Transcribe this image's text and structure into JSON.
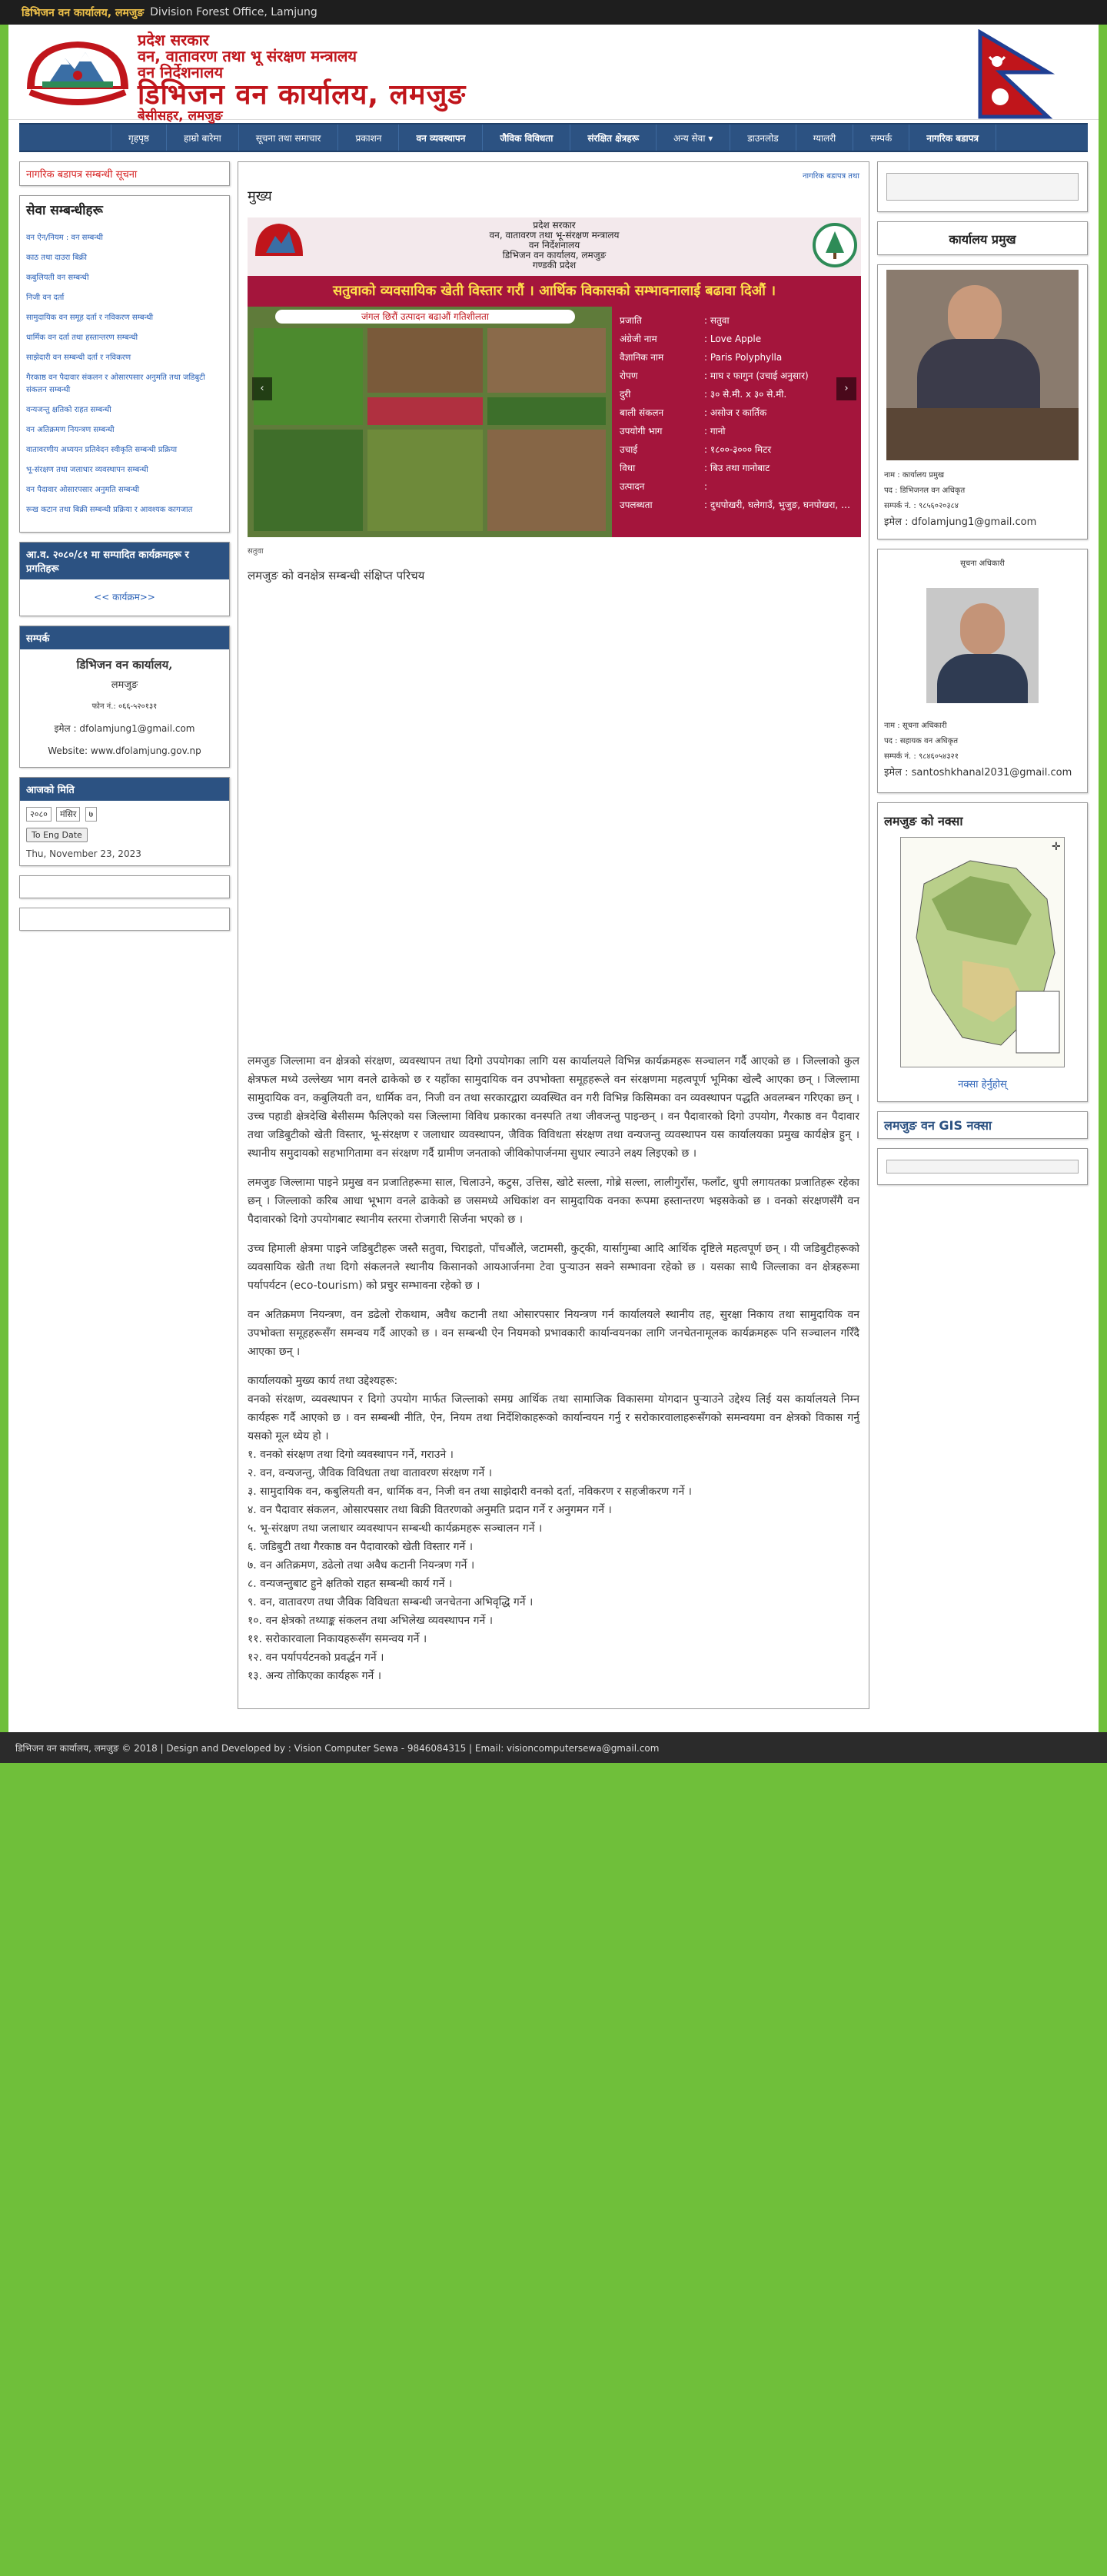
{
  "topbar": {
    "office_np": "डिभिजन वन कार्यालय, लमजुङ",
    "office_en": "Division Forest Office, Lamjung"
  },
  "header": {
    "line1": "प्रदेश सरकार",
    "line2": "वन, वातावरण तथा भू संरक्षण मन्त्रालय",
    "line3": "वन निर्देशनालय",
    "title": "डिभिजन वन कार्यालय, लमजुङ",
    "address": "बेसीसहर, लमजुङ"
  },
  "nav": [
    "गृहपृष्ठ",
    "हाम्रो बारेमा",
    "सूचना तथा समाचार",
    "प्रकाशन",
    "वन व्यवस्थापन",
    "जैविक विविधता",
    "संरक्षित क्षेत्रहरू",
    "अन्य सेवा ▾",
    "डाउनलोड",
    "ग्यालरी",
    "सम्पर्क",
    "नागरिक बडापत्र"
  ],
  "left": {
    "notice_title": "नागरिक बडापत्र सम्बन्धी सूचना",
    "services_title": "सेवा सम्बन्धीहरू",
    "service_links": [
      "वन ऐन/नियम : वन सम्बन्धी",
      "काठ तथा दाउरा बिक्री",
      "कबुलियती वन सम्बन्धी",
      "निजी वन दर्ता",
      "सामुदायिक वन समूह दर्ता र नविकरण सम्बन्धी",
      "धार्मिक वन दर्ता तथा हस्तान्तरण सम्बन्धी",
      "साझेदारी वन सम्बन्धी दर्ता र नविकरण",
      "गैरकाष्ठ वन पैदावार संकलन र ओसारपसार अनुमति तथा जडिबुटी संकलन सम्बन्धी",
      "वन्यजन्तु क्षतिको राहत सम्बन्धी",
      "वन अतिक्रमण नियन्त्रण सम्बन्धी",
      "वातावरणीय अध्ययन प्रतिवेदन स्वीकृति सम्बन्धी प्रक्रिया",
      "भू-संरक्षण तथा जलाधार व्यवस्थापन सम्बन्धी",
      "वन पैदावार ओसारपसार अनुमति सम्बन्धी",
      "रूख कटान तथा बिक्री सम्बन्धी प्रक्रिया र आवश्यक कागजात"
    ],
    "box3_title": "आ.व. २०८०/८१ मा सम्पादित कार्यक्रमहरू र प्रगतिहरू",
    "box3_link": "<< कार्यक्रम>>",
    "contact_title": "सम्पर्क",
    "contact_name": "डिभिजन वन कार्यालय,",
    "contact_place": "लमजुङ",
    "contact_phone": "फोन नं.: ०६६-५२०१३१",
    "contact_email": "इमेल : dfolamjung1@gmail.com",
    "contact_website": "Website: www.dfolamjung.gov.np",
    "date_title": "आजको मिति",
    "date_selects": [
      "२०८०",
      "मंसिर",
      "७"
    ],
    "date_button": "To Eng Date",
    "date_eng": "Thu, November 23, 2023"
  },
  "center": {
    "crumb": "नागरिक बडापत्र तथा",
    "title": "मुख्य",
    "banner": {
      "top1": "प्रदेश सरकार",
      "top2": "वन, वातावरण तथा भू-संरक्षण मन्त्रालय",
      "top3": "वन निर्देशनालय",
      "top4": "डिभिजन वन कार्यालय, लमजुङ",
      "top5": "गण्डकी प्रदेश",
      "slogan": "सतुवाको व्यवसायिक खेती विस्तार गरौं । आर्थिक विकासको सम्भावनालाई बढावा दिऔं ।",
      "tag": "जंगल छिरौं उत्पादन बढाऔं  गतिशीलता",
      "rows": [
        [
          "प्रजाति",
          ": सतुवा"
        ],
        [
          "अंग्रेजी नाम",
          ": Love Apple"
        ],
        [
          "वैज्ञानिक नाम",
          ": Paris Polyphylla"
        ],
        [
          "रोपण",
          ": माघ र फागुन (उचाई अनुसार)"
        ],
        [
          "दुरी",
          ": ३० से.मी. x ३० से.मी."
        ],
        [
          "बाली संकलन",
          ": असोज र कार्तिक"
        ],
        [
          "उपयोगी भाग",
          ": गानो"
        ],
        [
          "उचाई",
          ": १८००-३००० मिटर"
        ],
        [
          "विधा",
          ": बिउ तथा गानोबाट"
        ],
        [
          "उत्पादन",
          ":"
        ],
        [
          "उपलब्धता",
          ": दुधपोखरी, घलेगाउँ, भुजुङ, घनपोखरा, खुदी, तराई, ताघ्रिङ, ढोडेनी"
        ]
      ]
    },
    "caption": "सतुवा",
    "lead": "लमजुङ को वनक्षेत्र सम्बन्धी संक्षिप्त परिचय",
    "paragraphs": [
      "लमजुङ जिल्लामा वन क्षेत्रको संरक्षण, व्यवस्थापन तथा दिगो उपयोगका लागि यस कार्यालयले विभिन्न कार्यक्रमहरू सञ्चालन गर्दै आएको छ । जिल्लाको कुल क्षेत्रफल मध्ये उल्लेख्य भाग वनले ढाकेको छ र यहाँका सामुदायिक वन उपभोक्ता समूहहरूले वन संरक्षणमा महत्वपूर्ण भूमिका खेल्दै आएका छन् । जिल्लामा सामुदायिक वन, कबुलियती वन, धार्मिक वन, निजी वन तथा सरकारद्वारा व्यवस्थित वन गरी विभिन्न किसिमका वन व्यवस्थापन पद्धति अवलम्बन गरिएका छन् । उच्च पहाडी क्षेत्रदेखि बेसीसम्म फैलिएको यस जिल्लामा विविध प्रकारका वनस्पति तथा जीवजन्तु पाइन्छन् । वन पैदावारको दिगो उपयोग, गैरकाष्ठ वन पैदावार तथा जडिबुटीको खेती विस्तार, भू-संरक्षण र जलाधार व्यवस्थापन, जैविक विविधता संरक्षण तथा वन्यजन्तु व्यवस्थापन यस कार्यालयका प्रमुख कार्यक्षेत्र हुन् । स्थानीय समुदायको सहभागितामा वन संरक्षण गर्दै ग्रामीण जनताको जीविकोपार्जनमा सुधार ल्याउने लक्ष्य लिइएको छ ।",
      "लमजुङ जिल्लामा पाइने प्रमुख वन प्रजातिहरूमा साल, चिलाउने, कटुस, उत्तिस, खोटे सल्ला, गोब्रे सल्ला, लालीगुराँस, फलाँट, धुपी लगायतका प्रजातिहरू रहेका छन् । जिल्लाको करिब आधा भूभाग वनले ढाकेको छ जसमध्ये अधिकांश वन सामुदायिक वनका रूपमा हस्तान्तरण भइसकेको छ । वनको संरक्षणसँगै वन पैदावारको दिगो उपयोगबाट स्थानीय स्तरमा रोजगारी सिर्जना भएको छ ।",
      "उच्च हिमाली क्षेत्रमा पाइने जडिबुटीहरू जस्तै सतुवा, चिराइतो, पाँचऔंले, जटामसी, कुट्की, यार्सागुम्बा आदि आर्थिक दृष्टिले महत्वपूर्ण छन् । यी जडिबुटीहरूको व्यवसायिक खेती तथा दिगो संकलनले स्थानीय किसानको आयआर्जनमा टेवा पुर्‍याउन सक्ने सम्भावना रहेको छ । यसका साथै जिल्लाका वन क्षेत्रहरूमा पर्यापर्यटन (eco-tourism) को प्रचुर सम्भावना रहेको छ ।",
      "वन अतिक्रमण नियन्त्रण, वन डढेलो रोकथाम, अवैध कटानी तथा ओसारपसार नियन्त्रण गर्न कार्यालयले स्थानीय तह, सुरक्षा निकाय तथा सामुदायिक वन उपभोक्ता समूहहरूसँग समन्वय गर्दै आएको छ । वन सम्बन्धी ऐन नियमको प्रभावकारी कार्यान्वयनका लागि जनचेतनामूलक कार्यक्रमहरू पनि सञ्चालन गरिँदै आएका छन् ।"
    ],
    "bullet_heading": "कार्यालयको मुख्य कार्य तथा उद्देश्यहरू:",
    "bullet_intro": "वनको संरक्षण, व्यवस्थापन र दिगो उपयोग मार्फत जिल्लाको समग्र आर्थिक तथा सामाजिक विकासमा योगदान पुर्‍याउने उद्देश्य लिई यस कार्यालयले निम्न कार्यहरू गर्दै आएको छ । वन सम्बन्धी नीति, ऐन, नियम तथा निर्देशिकाहरूको कार्यान्वयन गर्नु र सरोकारवालाहरूसँगको समन्वयमा वन क्षेत्रको विकास गर्नु यसको मूल ध्येय हो ।",
    "bullets": [
      "१.  वनको संरक्षण तथा दिगो व्यवस्थापन गर्ने, गराउने ।",
      "२. वन, वन्यजन्तु, जैविक विविधता तथा वातावरण संरक्षण गर्ने ।",
      "३.  सामुदायिक वन, कबुलियती वन, धार्मिक वन, निजी वन तथा साझेदारी वनको दर्ता, नविकरण र सहजीकरण गर्ने ।",
      "४.  वन पैदावार संकलन, ओसारपसार तथा बिक्री वितरणको अनुमति प्रदान गर्ने र अनुगमन गर्ने ।",
      "५.  भू-संरक्षण तथा जलाधार व्यवस्थापन सम्बन्धी कार्यक्रमहरू सञ्चालन गर्ने ।",
      "६.  जडिबुटी तथा गैरकाष्ठ वन पैदावारको खेती विस्तार गर्ने ।",
      "७.  वन अतिक्रमण, डढेलो तथा अवैध कटानी नियन्त्रण गर्ने ।",
      "८.  वन्यजन्तुबाट हुने क्षतिको राहत सम्बन्धी कार्य गर्ने ।",
      "९.  वन, वातावरण तथा जैविक विविधता सम्बन्धी जनचेतना अभिवृद्धि गर्ने ।",
      "१०.  वन क्षेत्रको तथ्याङ्क संकलन तथा अभिलेख व्यवस्थापन गर्ने ।",
      "११.  सरोकारवाला निकायहरूसँग समन्वय गर्ने ।",
      "१२.  वन पर्यापर्यटनको प्रवर्द्धन गर्ने ।",
      "१३.  अन्य तोकिएका कार्यहरू गर्ने ।"
    ]
  },
  "right": {
    "office_head_title": "कार्यालय प्रमुख",
    "head_name": "नाम : कार्यालय प्रमुख",
    "head_post": "पद : डिभिजनल वन अधिकृत",
    "head_phone": "सम्पर्क नं. : ९८५६०२०३८४",
    "head_email": "इमेल : dfolamjung1@gmail.com",
    "info_title": "सूचना अधिकारी",
    "info_name": "नाम : सूचना अधिकारी",
    "info_post": "पद : सहायक वन अधिकृत",
    "info_phone": "सम्पर्क नं. : ९८४६०५४३२१",
    "info_email": "इमेल : santoshkhanal2031@gmail.com",
    "map_title": "लमजुङ को नक्सा",
    "map_link": "नक्सा हेर्नुहोस्",
    "gis_title": "लमजुङ वन GIS नक्सा"
  },
  "footer": {
    "text": "डिभिजन वन कार्यालय, लमजुङ © 2018 | Design and Developed by : Vision Computer Sewa - 9846084315 | Email: visioncomputersewa@gmail.com"
  },
  "colors": {
    "nav": "#2c5282",
    "accent_red": "#c0151b",
    "page_bg": "#6fbf3a",
    "banner": "#a4153c"
  }
}
